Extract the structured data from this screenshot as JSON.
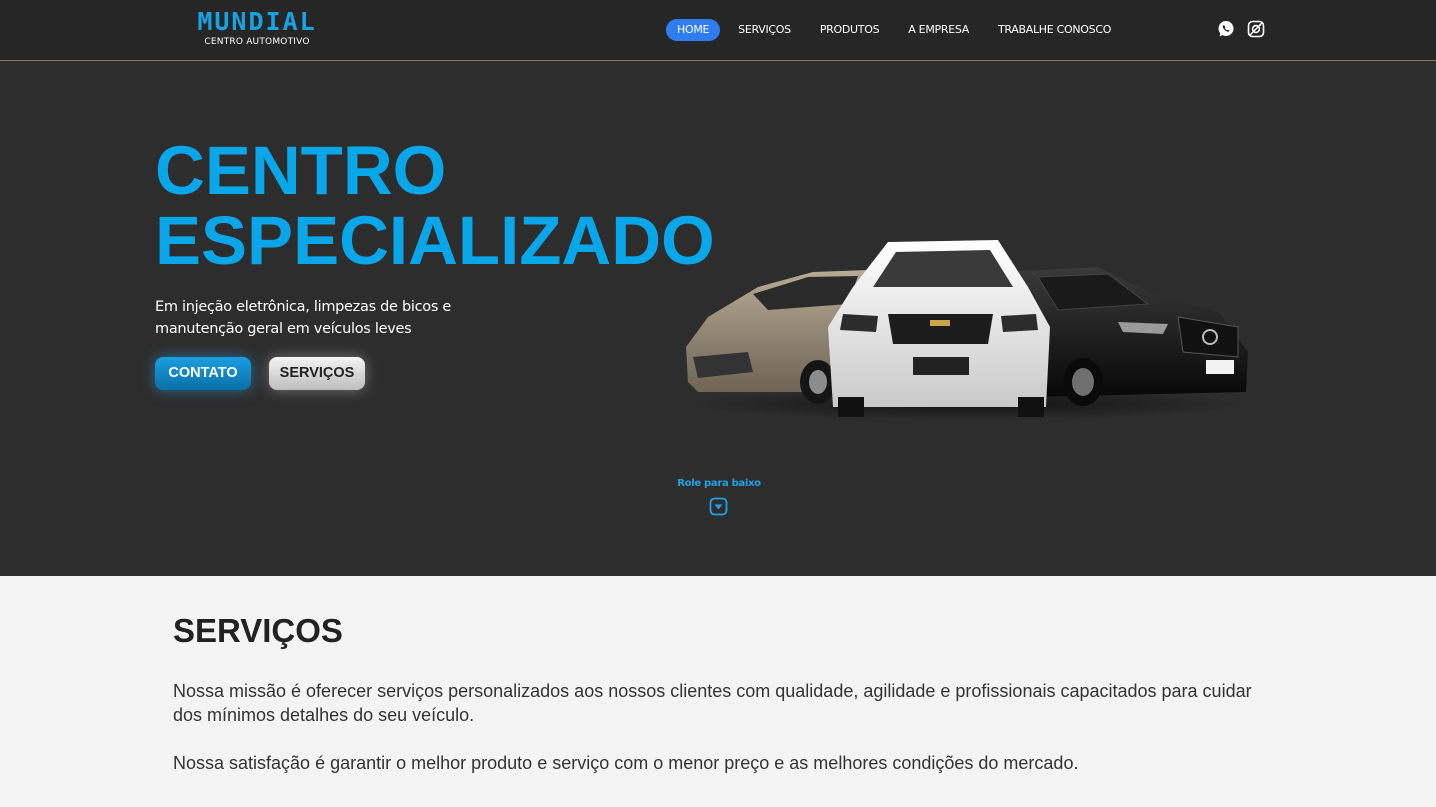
{
  "header": {
    "logo": {
      "name": "MUNDIAL",
      "subtitle": "CENTRO AUTOMOTIVO"
    },
    "nav": [
      {
        "label": "HOME",
        "active": true
      },
      {
        "label": "SERVIÇOS",
        "active": false
      },
      {
        "label": "PRODUTOS",
        "active": false
      },
      {
        "label": "A EMPRESA",
        "active": false
      },
      {
        "label": "TRABALHE CONOSCO",
        "active": false
      }
    ],
    "social": [
      "whatsapp-icon",
      "instagram-icon"
    ]
  },
  "hero": {
    "title_line1": "CENTRO",
    "title_line2": "ESPECIALIZADO",
    "subtitle": "Em injeção eletrônica, limpezas de bicos e manutenção geral em veículos leves",
    "contact_button": "CONTATO",
    "services_button": "SERVIÇOS",
    "scroll_hint": "Role para baixo"
  },
  "services": {
    "title": "SERVIÇOS",
    "paragraph1": "Nossa missão é oferecer serviços personalizados aos nossos clientes com qualidade, agilidade e profissionais capacitados para cuidar dos mínimos detalhes do seu veículo.",
    "paragraph2": "Nossa satisfação é garantir o melhor produto e serviço com o menor preço e as melhores condições do mercado."
  },
  "colors": {
    "accent": "#0aa6ea",
    "nav_active": "#2f7df0",
    "header_bg": "#262626",
    "hero_bg": "#2d2d2d",
    "section_bg": "#f4f4f4"
  }
}
